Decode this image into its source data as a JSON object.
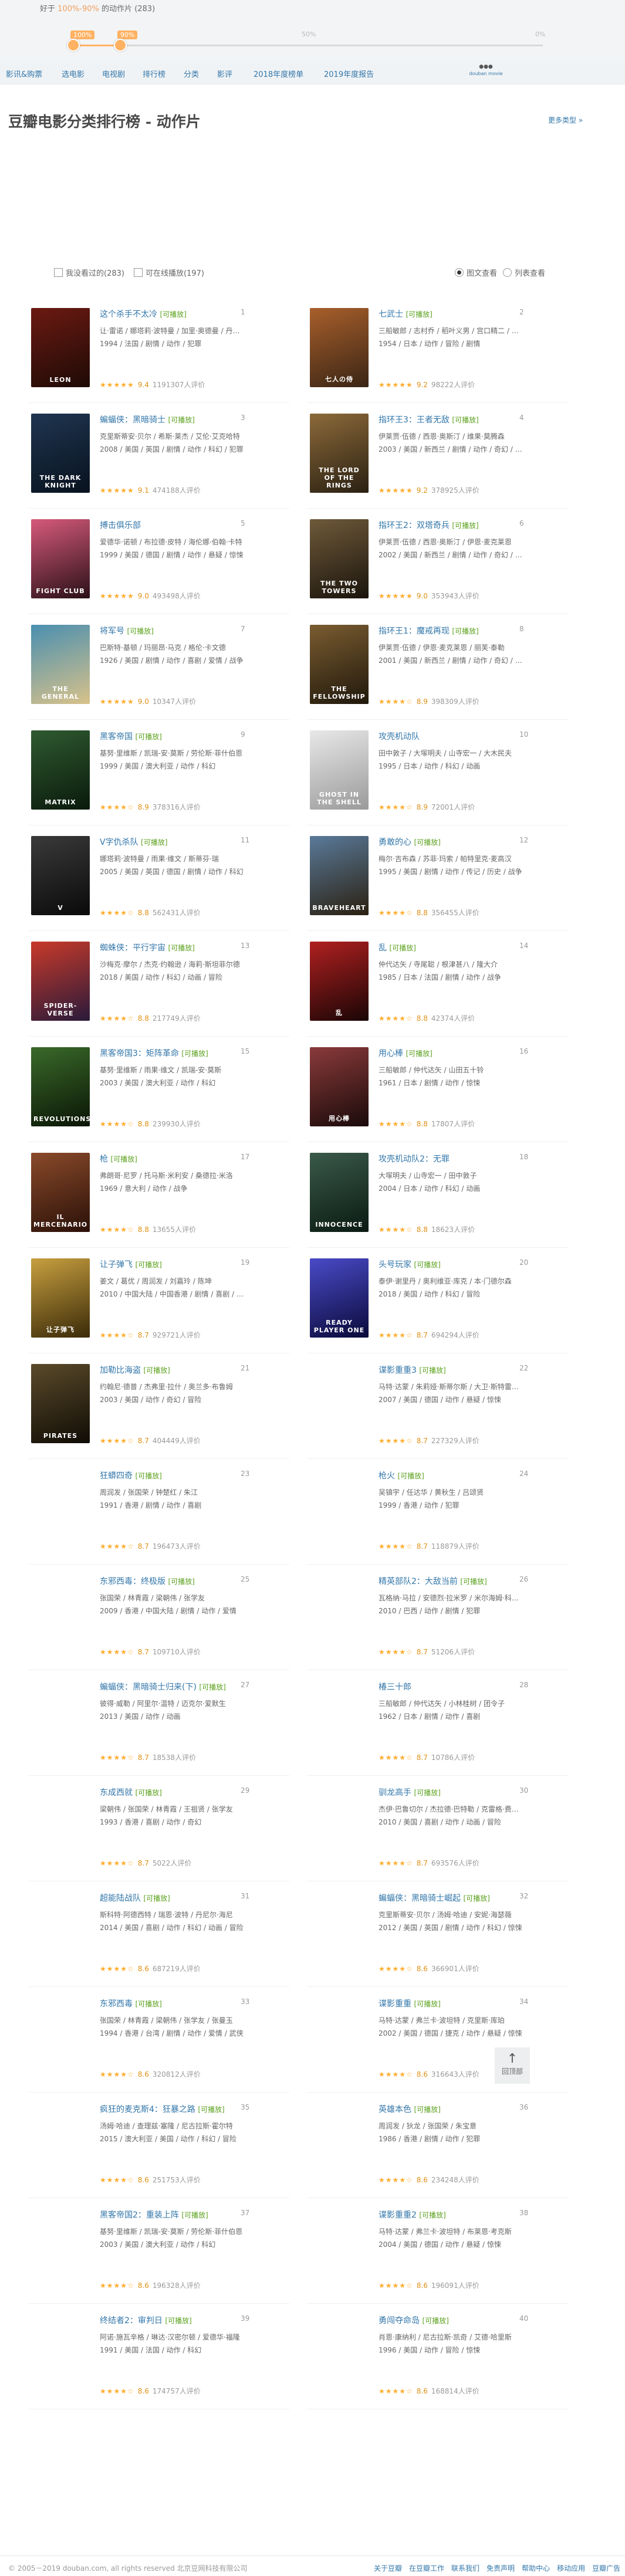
{
  "filter_bar": {
    "label_prefix": "好于",
    "label_range": "100%-90%",
    "label_suffix": "的动作片 (283)",
    "range": {
      "low_pct": 100,
      "high_pct": 90
    },
    "tick_100": "100%",
    "tick_90": "90%",
    "tick_50": "50%",
    "tick_0": "0%"
  },
  "nav": {
    "items": [
      "影讯&购票",
      "选电影",
      "电视剧",
      "排行榜",
      "分类",
      "影评",
      "2018年度榜单",
      "2019年度报告"
    ],
    "logo_text": "douban movie"
  },
  "header": {
    "title": "豆瓣电影分类排行榜 - 动作片",
    "more_link": "更多类型 »"
  },
  "filters": {
    "watched": "我没看过的(283)",
    "playable": "可在线播放(197)"
  },
  "view": {
    "image_view": "图文查看",
    "list_view": "列表查看"
  },
  "playable_tag": "[可播放]",
  "movies": [
    {
      "rank": "1",
      "title": "这个杀手不太冷",
      "playable": true,
      "cast": "让·雷诺 / 娜塔莉·波特曼 / 加里·奥德曼 / 丹尼·爱罗",
      "info": "1994 / 法国 / 剧情 / 动作 / 犯罪",
      "score": "9.4",
      "votes": "1191307人评价",
      "colors": [
        "#6b1a12",
        "#1e0a06"
      ],
      "poster_text": "LEON"
    },
    {
      "rank": "2",
      "title": "七武士",
      "playable": true,
      "cast": "三船敏郎 / 志村乔 / 稻叶义男 / 宫口精二 / 千秋实",
      "info": "1954 / 日本 / 动作 / 冒险 / 剧情",
      "score": "9.2",
      "votes": "98222人评价",
      "colors": [
        "#a85f2b",
        "#3a2515"
      ],
      "poster_text": "七人の侍"
    },
    {
      "rank": "3",
      "title": "蝙蝠侠：黑暗骑士",
      "playable": true,
      "cast": "克里斯蒂安·贝尔 / 希斯·莱杰 / 艾伦·艾克哈特",
      "info": "2008 / 美国 / 英国 / 剧情 / 动作 / 科幻 / 犯罪",
      "score": "9.1",
      "votes": "474188人评价",
      "colors": [
        "#1f3550",
        "#08121e"
      ],
      "poster_text": "THE DARK KNIGHT"
    },
    {
      "rank": "4",
      "title": "指环王3：王者无敌",
      "playable": true,
      "cast": "伊莱贾·伍德 / 西恩·奥斯汀 / 维果·莫腾森",
      "info": "2003 / 美国 / 新西兰 / 剧情 / 动作 / 奇幻 / 冒险",
      "score": "9.2",
      "votes": "378925人评价",
      "colors": [
        "#8c6a3a",
        "#2a2012"
      ],
      "poster_text": "THE LORD OF THE RINGS"
    },
    {
      "rank": "5",
      "title": "搏击俱乐部",
      "playable": false,
      "cast": "爱德华·诺顿 / 布拉德·皮特 / 海伦娜·伯翰·卡特",
      "info": "1999 / 美国 / 德国 / 剧情 / 动作 / 悬疑 / 惊悚",
      "score": "9.0",
      "votes": "493498人评价",
      "colors": [
        "#d65a7a",
        "#2a1018"
      ],
      "poster_text": "FIGHT CLUB"
    },
    {
      "rank": "6",
      "title": "指环王2：双塔奇兵",
      "playable": true,
      "cast": "伊莱贾·伍德 / 西恩·奥斯汀 / 伊恩·麦克莱恩",
      "info": "2002 / 美国 / 新西兰 / 剧情 / 动作 / 奇幻 / 冒险",
      "score": "9.0",
      "votes": "353943人评价",
      "colors": [
        "#6f5a3a",
        "#1a140c"
      ],
      "poster_text": "THE TWO TOWERS"
    },
    {
      "rank": "7",
      "title": "将军号",
      "playable": true,
      "cast": "巴斯特·基顿 / 玛丽昂·马克 / 格伦·卡文德",
      "info": "1926 / 美国 / 剧情 / 动作 / 喜剧 / 爱情 / 战争",
      "score": "9.0",
      "votes": "10347人评价",
      "colors": [
        "#4a8fb0",
        "#d8c28a"
      ],
      "poster_text": "THE GENERAL"
    },
    {
      "rank": "8",
      "title": "指环王1：魔戒再现",
      "playable": true,
      "cast": "伊莱贾·伍德 / 伊恩·麦克莱恩 / 丽芙·泰勒",
      "info": "2001 / 美国 / 新西兰 / 剧情 / 动作 / 奇幻 / 冒险",
      "score": "8.9",
      "votes": "398309人评价",
      "colors": [
        "#7a5c30",
        "#20180c"
      ],
      "poster_text": "THE FELLOWSHIP"
    },
    {
      "rank": "9",
      "title": "黑客帝国",
      "playable": true,
      "cast": "基努·里维斯 / 凯瑞-安·莫斯 / 劳伦斯·菲什伯恩",
      "info": "1999 / 美国 / 澳大利亚 / 动作 / 科幻",
      "score": "8.9",
      "votes": "378316人评价",
      "colors": [
        "#2f5a30",
        "#0a1a0c"
      ],
      "poster_text": "MATRIX"
    },
    {
      "rank": "10",
      "title": "攻壳机动队",
      "playable": false,
      "cast": "田中敦子 / 大塚明夫 / 山寺宏一 / 大木民夫",
      "info": "1995 / 日本 / 动作 / 科幻 / 动画",
      "score": "8.9",
      "votes": "72001人评价",
      "colors": [
        "#e8e8e8",
        "#9a9a9a"
      ],
      "poster_text": "GHOST IN THE SHELL"
    },
    {
      "rank": "11",
      "title": "V字仇杀队",
      "playable": true,
      "cast": "娜塔莉·波特曼 / 雨果·维文 / 斯蒂芬·瑞",
      "info": "2005 / 美国 / 英国 / 德国 / 剧情 / 动作 / 科幻",
      "score": "8.8",
      "votes": "562431人评价",
      "colors": [
        "#3a3a3a",
        "#0a0a0a"
      ],
      "poster_text": "V"
    },
    {
      "rank": "12",
      "title": "勇敢的心",
      "playable": true,
      "cast": "梅尔·吉布森 / 苏菲·玛索 / 帕特里克·麦高汉",
      "info": "1995 / 美国 / 剧情 / 动作 / 传记 / 历史 / 战争",
      "score": "8.8",
      "votes": "356455人评价",
      "colors": [
        "#5a7a9a",
        "#2a2010"
      ],
      "poster_text": "BRAVEHEART"
    },
    {
      "rank": "13",
      "title": "蜘蛛侠：平行宇宙",
      "playable": true,
      "cast": "沙梅克·摩尔 / 杰克·约翰逊 / 海莉·斯坦菲尔德",
      "info": "2018 / 美国 / 动作 / 科幻 / 动画 / 冒险",
      "score": "8.8",
      "votes": "217749人评价",
      "colors": [
        "#c83a2a",
        "#2a1a3a"
      ],
      "poster_text": "SPIDER-VERSE"
    },
    {
      "rank": "14",
      "title": "乱",
      "playable": true,
      "cast": "仲代达矢 / 寺尾聪 / 根津甚八 / 隆大介",
      "info": "1985 / 日本 / 法国 / 剧情 / 动作 / 战争",
      "score": "8.8",
      "votes": "42374人评价",
      "colors": [
        "#b02020",
        "#1a0505"
      ],
      "poster_text": "乱"
    },
    {
      "rank": "15",
      "title": "黑客帝国3：矩阵革命",
      "playable": true,
      "cast": "基努·里维斯 / 雨果·维文 / 凯瑞-安·莫斯",
      "info": "2003 / 美国 / 澳大利亚 / 动作 / 科幻",
      "score": "8.8",
      "votes": "239930人评价",
      "colors": [
        "#3a6a2a",
        "#0a1505"
      ],
      "poster_text": "REVOLUTIONS"
    },
    {
      "rank": "16",
      "title": "用心棒",
      "playable": true,
      "cast": "三船敏郎 / 仲代达矢 / 山田五十铃",
      "info": "1961 / 日本 / 剧情 / 动作 / 惊悚",
      "score": "8.8",
      "votes": "17807人评价",
      "colors": [
        "#8a3a3a",
        "#1a0a0a"
      ],
      "poster_text": "用心棒"
    },
    {
      "rank": "17",
      "title": "枪",
      "playable": true,
      "cast": "弗朗哥·尼罗 / 托马斯·米利安 / 桑德拉·米洛",
      "info": "1969 / 意大利 / 动作 / 战争",
      "score": "8.8",
      "votes": "13655人评价",
      "colors": [
        "#8a4a2a",
        "#2a1008"
      ],
      "poster_text": "IL MERCENARIO"
    },
    {
      "rank": "18",
      "title": "攻壳机动队2：无罪",
      "playable": false,
      "cast": "大塚明夫 / 山寺宏一 / 田中敦子",
      "info": "2004 / 日本 / 动作 / 科幻 / 动画",
      "score": "8.8",
      "votes": "18623人评价",
      "colors": [
        "#3a5a4a",
        "#0a1a12"
      ],
      "poster_text": "INNOCENCE"
    },
    {
      "rank": "19",
      "title": "让子弹飞",
      "playable": true,
      "cast": "姜文 / 葛优 / 周润发 / 刘嘉玲 / 陈坤",
      "info": "2010 / 中国大陆 / 中国香港 / 剧情 / 喜剧 / 动作",
      "score": "8.7",
      "votes": "929721人评价",
      "colors": [
        "#c8a040",
        "#3a2a08"
      ],
      "poster_text": "让子弹飞"
    },
    {
      "rank": "20",
      "title": "头号玩家",
      "playable": true,
      "cast": "泰伊·谢里丹 / 奥利维亚·库克 / 本·门德尔森",
      "info": "2018 / 美国 / 动作 / 科幻 / 冒险",
      "score": "8.7",
      "votes": "694294人评价",
      "colors": [
        "#4a4ac8",
        "#0a0a3a"
      ],
      "poster_text": "READY PLAYER ONE"
    },
    {
      "rank": "21",
      "title": "加勒比海盗",
      "playable": true,
      "cast": "约翰尼·德普 / 杰弗里·拉什 / 奥兰多·布鲁姆",
      "info": "2003 / 美国 / 动作 / 奇幻 / 冒险",
      "score": "8.7",
      "votes": "404449人评价",
      "colors": [
        "#5a4a2a",
        "#100c05"
      ],
      "poster_text": "PIRATES"
    },
    {
      "rank": "22",
      "title": "谍影重重3",
      "playable": true,
      "cast": "马特·达蒙 / 朱莉娅·斯蒂尔斯 / 大卫·斯特雷泽恩",
      "info": "2007 / 美国 / 德国 / 动作 / 悬疑 / 惊悚",
      "score": "8.7",
      "votes": "227329人评价",
      "colors": [
        "",
        ""
      ],
      "poster_text": ""
    },
    {
      "rank": "23",
      "title": "狂蟒四奇",
      "playable": true,
      "cast": "周润发 / 张国荣 / 钟楚红 / 朱江",
      "info": "1991 / 香港 / 剧情 / 动作 / 喜剧",
      "score": "8.7",
      "votes": "196473人评价",
      "colors": [
        "",
        ""
      ],
      "poster_text": ""
    },
    {
      "rank": "24",
      "title": "枪火",
      "playable": true,
      "cast": "吴镇宇 / 任达华 / 黄秋生 / 吕颂贤",
      "info": "1999 / 香港 / 动作 / 犯罪",
      "score": "8.7",
      "votes": "118879人评价",
      "colors": [
        "",
        ""
      ],
      "poster_text": ""
    },
    {
      "rank": "25",
      "title": "东邪西毒：终极版",
      "playable": true,
      "cast": "张国荣 / 林青霞 / 梁朝伟 / 张学友",
      "info": "2009 / 香港 / 中国大陆 / 剧情 / 动作 / 爱情",
      "score": "8.7",
      "votes": "109710人评价",
      "colors": [
        "",
        ""
      ],
      "poster_text": ""
    },
    {
      "rank": "26",
      "title": "精英部队2：大敌当前",
      "playable": true,
      "cast": "瓦格纳·马拉 / 安德烈·拉米罗 / 米尔海姆·科尔特斯",
      "info": "2010 / 巴西 / 动作 / 剧情 / 犯罪",
      "score": "8.7",
      "votes": "51206人评价",
      "colors": [
        "",
        ""
      ],
      "poster_text": ""
    },
    {
      "rank": "27",
      "title": "蝙蝠侠：黑暗骑士归来(下)",
      "playable": true,
      "cast": "彼得·威勒 / 阿里尔·温特 / 迈克尔·爱默生",
      "info": "2013 / 美国 / 动作 / 动画",
      "score": "8.7",
      "votes": "18538人评价",
      "colors": [
        "",
        ""
      ],
      "poster_text": ""
    },
    {
      "rank": "28",
      "title": "椿三十郎",
      "playable": false,
      "cast": "三船敏郎 / 仲代达矢 / 小林桂树 / 团令子",
      "info": "1962 / 日本 / 剧情 / 动作 / 喜剧",
      "score": "8.7",
      "votes": "10786人评价",
      "colors": [
        "",
        ""
      ],
      "poster_text": ""
    },
    {
      "rank": "29",
      "title": "东成西就",
      "playable": true,
      "cast": "梁朝伟 / 张国荣 / 林青霞 / 王祖贤 / 张学友",
      "info": "1993 / 香港 / 喜剧 / 动作 / 奇幻",
      "score": "8.7",
      "votes": "5022人评价",
      "colors": [
        "",
        ""
      ],
      "poster_text": ""
    },
    {
      "rank": "30",
      "title": "驯龙高手",
      "playable": true,
      "cast": "杰伊·巴鲁切尔 / 杰拉德·巴特勒 / 克雷格·费格森",
      "info": "2010 / 美国 / 喜剧 / 动作 / 动画 / 冒险",
      "score": "8.7",
      "votes": "693576人评价",
      "colors": [
        "",
        ""
      ],
      "poster_text": ""
    },
    {
      "rank": "31",
      "title": "超能陆战队",
      "playable": true,
      "cast": "斯科特·阿德西特 / 瑞恩·波特 / 丹尼尔·海尼",
      "info": "2014 / 美国 / 喜剧 / 动作 / 科幻 / 动画 / 冒险",
      "score": "8.6",
      "votes": "687219人评价",
      "colors": [
        "",
        ""
      ],
      "poster_text": ""
    },
    {
      "rank": "32",
      "title": "蝙蝠侠：黑暗骑士崛起",
      "playable": true,
      "cast": "克里斯蒂安·贝尔 / 汤姆·哈迪 / 安妮·海瑟薇",
      "info": "2012 / 美国 / 英国 / 剧情 / 动作 / 科幻 / 惊悚",
      "score": "8.6",
      "votes": "366901人评价",
      "colors": [
        "",
        ""
      ],
      "poster_text": ""
    },
    {
      "rank": "33",
      "title": "东邪西毒",
      "playable": true,
      "cast": "张国荣 / 林青霞 / 梁朝伟 / 张学友 / 张曼玉",
      "info": "1994 / 香港 / 台湾 / 剧情 / 动作 / 爱情 / 武侠",
      "score": "8.6",
      "votes": "320812人评价",
      "colors": [
        "",
        ""
      ],
      "poster_text": ""
    },
    {
      "rank": "34",
      "title": "谍影重重",
      "playable": true,
      "cast": "马特·达蒙 / 弗兰卡·波坦特 / 克里斯·库珀",
      "info": "2002 / 美国 / 德国 / 捷克 / 动作 / 悬疑 / 惊悚",
      "score": "8.6",
      "votes": "316643人评价",
      "colors": [
        "",
        ""
      ],
      "poster_text": ""
    },
    {
      "rank": "35",
      "title": "疯狂的麦克斯4：狂暴之路",
      "playable": true,
      "cast": "汤姆·哈迪 / 查理兹·塞隆 / 尼古拉斯·霍尔特",
      "info": "2015 / 澳大利亚 / 美国 / 动作 / 科幻 / 冒险",
      "score": "8.6",
      "votes": "251753人评价",
      "colors": [
        "",
        ""
      ],
      "poster_text": ""
    },
    {
      "rank": "36",
      "title": "英雄本色",
      "playable": true,
      "cast": "周润发 / 狄龙 / 张国荣 / 朱宝意",
      "info": "1986 / 香港 / 剧情 / 动作 / 犯罪",
      "score": "8.6",
      "votes": "234248人评价",
      "colors": [
        "",
        ""
      ],
      "poster_text": ""
    },
    {
      "rank": "37",
      "title": "黑客帝国2：重装上阵",
      "playable": true,
      "cast": "基努·里维斯 / 凯瑞-安·莫斯 / 劳伦斯·菲什伯恩",
      "info": "2003 / 美国 / 澳大利亚 / 动作 / 科幻",
      "score": "8.6",
      "votes": "196328人评价",
      "colors": [
        "",
        ""
      ],
      "poster_text": ""
    },
    {
      "rank": "38",
      "title": "谍影重重2",
      "playable": true,
      "cast": "马特·达蒙 / 弗兰卡·波坦特 / 布莱恩·考克斯",
      "info": "2004 / 美国 / 德国 / 动作 / 悬疑 / 惊悚",
      "score": "8.6",
      "votes": "196091人评价",
      "colors": [
        "",
        ""
      ],
      "poster_text": ""
    },
    {
      "rank": "39",
      "title": "终结者2：审判日",
      "playable": true,
      "cast": "阿诺·施瓦辛格 / 琳达·汉密尔顿 / 爱德华·福隆",
      "info": "1991 / 美国 / 法国 / 动作 / 科幻",
      "score": "8.6",
      "votes": "174757人评价",
      "colors": [
        "",
        ""
      ],
      "poster_text": ""
    },
    {
      "rank": "40",
      "title": "勇闯夺命岛",
      "playable": true,
      "cast": "肖恩·康纳利 / 尼古拉斯·凯奇 / 艾德·哈里斯",
      "info": "1996 / 美国 / 动作 / 冒险 / 惊悚",
      "score": "8.6",
      "votes": "168814人评价",
      "colors": [
        "",
        ""
      ],
      "poster_text": ""
    }
  ],
  "totop": {
    "label": "回顶部"
  },
  "footer": {
    "copyright": "© 2005－2019 douban.com, all rights reserved 北京豆网科技有限公司",
    "links": [
      "关于豆瓣",
      "在豆瓣工作",
      "联系我们",
      "免责声明",
      "帮助中心",
      "移动应用",
      "豆瓣广告"
    ]
  }
}
